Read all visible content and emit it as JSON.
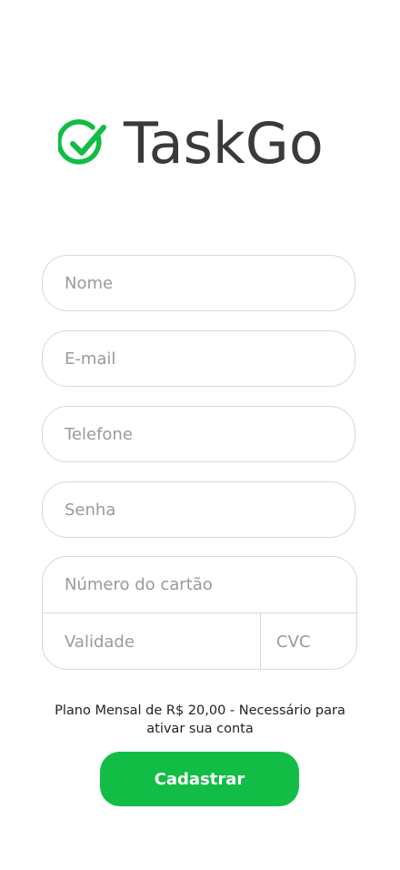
{
  "brand": {
    "name": "TaskGo",
    "icon": "check-circle-icon",
    "accent_color": "#11bd44"
  },
  "form": {
    "name_placeholder": "Nome",
    "email_placeholder": "E-mail",
    "phone_placeholder": "Telefone",
    "password_placeholder": "Senha",
    "card_number_placeholder": "Número do cartão",
    "expiry_placeholder": "Validade",
    "cvc_placeholder": "CVC"
  },
  "plan_note": "Plano Mensal de R$ 20,00 - Necessário para ativar sua conta",
  "submit_label": "Cadastrar"
}
